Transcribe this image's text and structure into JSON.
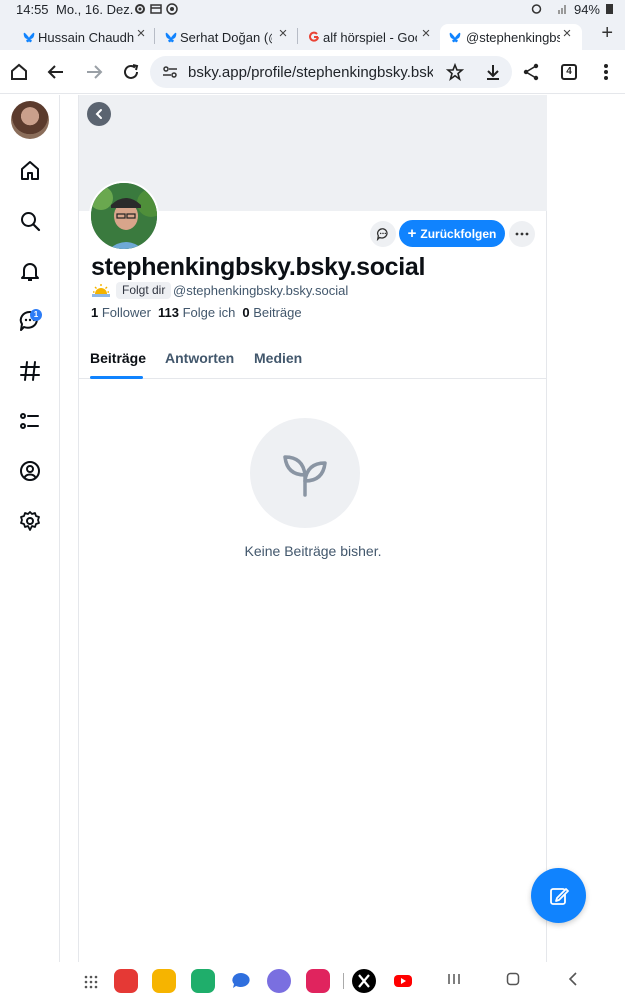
{
  "status_bar": {
    "time": "14:55",
    "date": "Mo., 16. Dez.",
    "battery": "94%"
  },
  "tabs": [
    {
      "label": "Hussain Chaudha",
      "favicon": "bluesky-icon"
    },
    {
      "label": "Serhat Doğan (@",
      "favicon": "bluesky-icon"
    },
    {
      "label": "alf hörspiel - Goo",
      "favicon": "google-icon"
    },
    {
      "label": "@stephenkingbsk",
      "favicon": "bluesky-icon",
      "active": true
    }
  ],
  "browser": {
    "url": "bsky.app/profile/stephenkingbsky.bsky.s",
    "tab_count": "4"
  },
  "profile": {
    "display_name": "stephenkingbsky.bsky.social",
    "follows_you": "Folgt dir",
    "handle": "@stephenkingbsky.bsky.social",
    "followers_count": "1",
    "followers_label": "Follower",
    "following_count": "113",
    "following_label": "Folge ich",
    "posts_count": "0",
    "posts_label": "Beiträge",
    "follow_back_label": "Zurückfolgen"
  },
  "profile_tabs": [
    "Beiträge",
    "Antworten",
    "Medien"
  ],
  "empty_state": {
    "text": "Keine Beiträge bisher."
  },
  "nav": {
    "chat_badge": "1"
  },
  "colors": {
    "accent": "#1083fe",
    "text_secondary": "#42576c",
    "banner": "#eef0f3"
  }
}
